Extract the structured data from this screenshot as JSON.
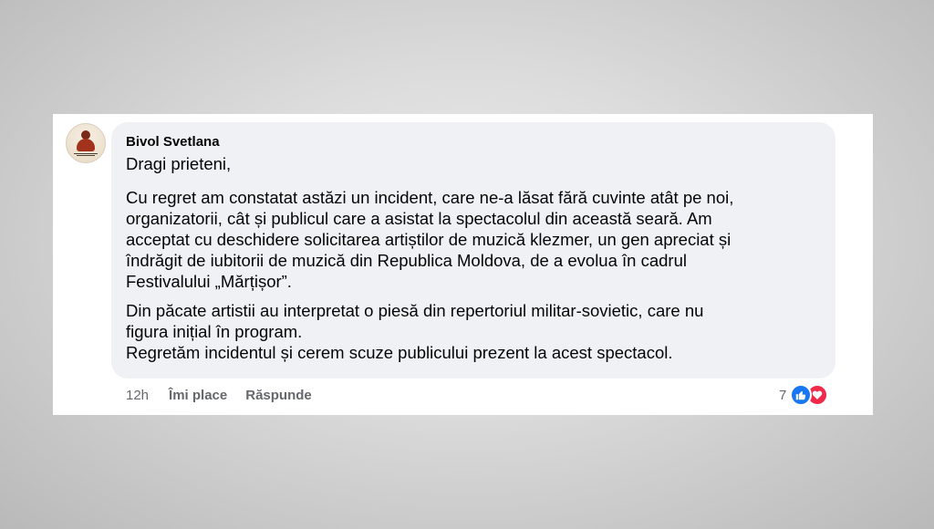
{
  "comment": {
    "author": "Bivol Svetlana",
    "greeting": "Dragi prieteni,",
    "paragraph1": [
      "Cu regret am constatat astăzi un incident, care ne-a lăsat fără cuvinte atât pe noi,",
      "organizatorii, cât și publicul care a asistat la spectacolul din această seară. Am",
      "acceptat cu deschidere solicitarea artiștilor de muzică klezmer, un gen apreciat și",
      "îndrăgit de iubitorii de muzică din Republica Moldova, de a evolua în cadrul",
      "Festivalului „Mărțișor”."
    ],
    "paragraph2": [
      "Din păcate artistii au interpretat o piesă din repertoriul militar-sovietic, care nu",
      "figura inițial în program.",
      "Regretăm incidentul și cerem scuze publicului prezent la acest spectacol."
    ]
  },
  "actions": {
    "time": "12h",
    "like_label": "Îmi place",
    "reply_label": "Răspunde"
  },
  "reactions": {
    "count": "7",
    "icons": [
      "like-icon",
      "love-icon"
    ],
    "colors": {
      "like": "#1877f2",
      "love": "#f0284a"
    }
  },
  "colors": {
    "bubble_bg": "#eff1f4",
    "text": "#050505",
    "meta": "#65676b"
  }
}
